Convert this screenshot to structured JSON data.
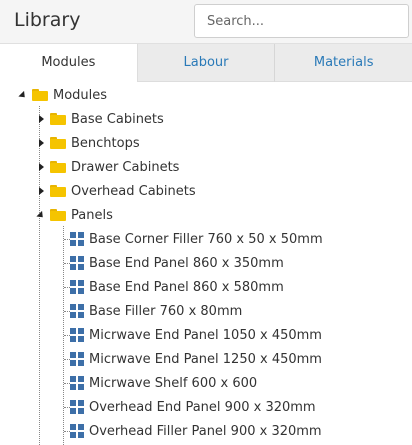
{
  "header": {
    "title": "Library",
    "search_placeholder": "Search..."
  },
  "tabs": [
    {
      "label": "Modules",
      "active": true
    },
    {
      "label": "Labour",
      "active": false
    },
    {
      "label": "Materials",
      "active": false
    }
  ],
  "tree": {
    "root": "Modules",
    "folders": [
      {
        "label": "Base Cabinets",
        "expanded": false
      },
      {
        "label": "Benchtops",
        "expanded": false
      },
      {
        "label": "Drawer Cabinets",
        "expanded": false
      },
      {
        "label": "Overhead Cabinets",
        "expanded": false
      },
      {
        "label": "Panels",
        "expanded": true
      }
    ],
    "panel_items": [
      "Base Corner Filler 760 x 50 x 50mm",
      "Base End Panel 860 x 350mm",
      "Base End Panel 860 x 580mm",
      "Base Filler 760 x 80mm",
      "Micrwave End Panel 1050 x 450mm",
      "Micrwave End Panel 1250 x 450mm",
      "Micrwave Shelf 600 x 600",
      "Overhead End Panel 900 x 320mm",
      "Overhead Filler Panel 900 x 320mm"
    ]
  },
  "colors": {
    "folder": "#f5c400",
    "module_icon": "#3d6fa8",
    "tab_link": "#2a7ab8"
  }
}
